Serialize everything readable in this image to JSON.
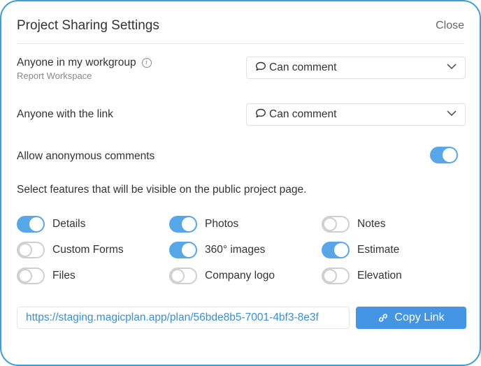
{
  "dialog": {
    "title": "Project Sharing Settings",
    "close_label": "Close"
  },
  "workgroup": {
    "label": "Anyone in my workgroup",
    "sublabel": "Report Workspace",
    "info_icon": "info-icon",
    "permission": "Can comment"
  },
  "link_access": {
    "label": "Anyone with the link",
    "permission": "Can comment"
  },
  "anonymous": {
    "label": "Allow anonymous comments",
    "enabled": true
  },
  "features": {
    "heading": "Select features that will be visible on the public project page.",
    "items": [
      {
        "label": "Details",
        "enabled": true
      },
      {
        "label": "Photos",
        "enabled": true
      },
      {
        "label": "Notes",
        "enabled": false
      },
      {
        "label": "Custom Forms",
        "enabled": false
      },
      {
        "label": "360° images",
        "enabled": true
      },
      {
        "label": "Estimate",
        "enabled": true
      },
      {
        "label": "Files",
        "enabled": false
      },
      {
        "label": "Company logo",
        "enabled": false
      },
      {
        "label": "Elevation",
        "enabled": false
      }
    ]
  },
  "share_link": {
    "url": "https://staging.magicplan.app/plan/56bde8b5-7001-4bf3-8e3f",
    "copy_label": "Copy Link"
  },
  "colors": {
    "accent": "#57a6e8",
    "button": "#4496e4",
    "link_text": "#3a8fd0",
    "border": "#3ba0d6"
  }
}
